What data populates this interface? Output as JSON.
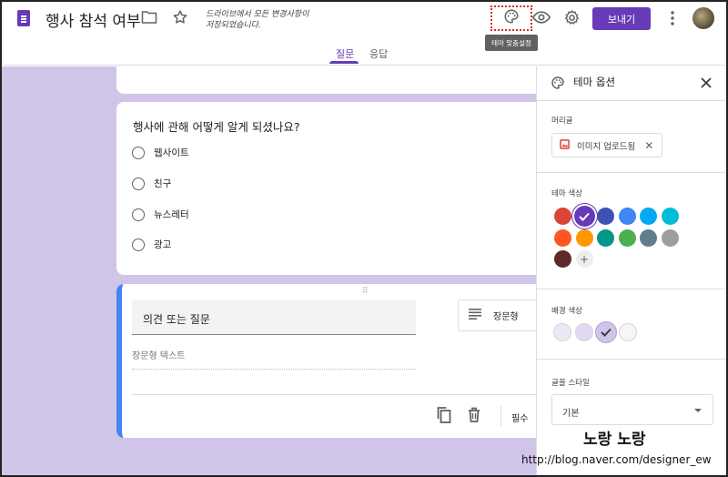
{
  "header": {
    "title": "행사 참석 여부",
    "saved_text": "드라이브에서 모든 변경사항이 저장되었습니다.",
    "tooltip": "테마 맞춤설정",
    "send_label": "보내기"
  },
  "tabs": [
    {
      "label": "질문",
      "active": true
    },
    {
      "label": "응답",
      "active": false
    }
  ],
  "question1": {
    "title": "행사에 관해 어떻게 알게 되셨나요?",
    "options": [
      "웹사이트",
      "친구",
      "뉴스레터",
      "광고"
    ]
  },
  "question2": {
    "title": "의견 또는 질문",
    "type_label": "장문형",
    "answer_placeholder": "장문형 텍스트",
    "required_label": "필수"
  },
  "panel": {
    "title": "테마 옵션",
    "header_label": "머리글",
    "upload_label": "이미지 업로드됨",
    "theme_color_label": "테마 색상",
    "theme_colors": [
      "#db4437",
      "#673ab7",
      "#3f51b5",
      "#4285f4",
      "#03a9f4",
      "#00bcd4",
      "#ff5722",
      "#ff9800",
      "#009688",
      "#4caf50",
      "#607d8b",
      "#9e9e9e",
      "#5d2a25"
    ],
    "selected_theme_color": "#673ab7",
    "bg_color_label": "배경 색상",
    "bg_colors": [
      "#ede7f6",
      "#e1d9f2",
      "#d1c4e9",
      "#f6f6f6"
    ],
    "selected_bg_color": "#d1c4e9",
    "font_style_label": "글꼴 스타일",
    "font_style_value": "기본"
  },
  "watermark": {
    "line1": "노랑 노랑",
    "line2": "http://blog.naver.com/designer_ew"
  },
  "icons": [
    "forms-doc-icon",
    "folder-icon",
    "star-icon",
    "palette-icon",
    "eye-icon",
    "gear-icon",
    "more-vert-icon",
    "copy-icon",
    "trash-icon",
    "close-icon",
    "image-icon",
    "check-icon",
    "add-icon",
    "dropdown-icon",
    "drag-handle-icon",
    "long-text-icon"
  ],
  "colors": {
    "accent": "#673ab7",
    "page_bg": "#d1c4e9",
    "active_border": "#4285f4"
  }
}
